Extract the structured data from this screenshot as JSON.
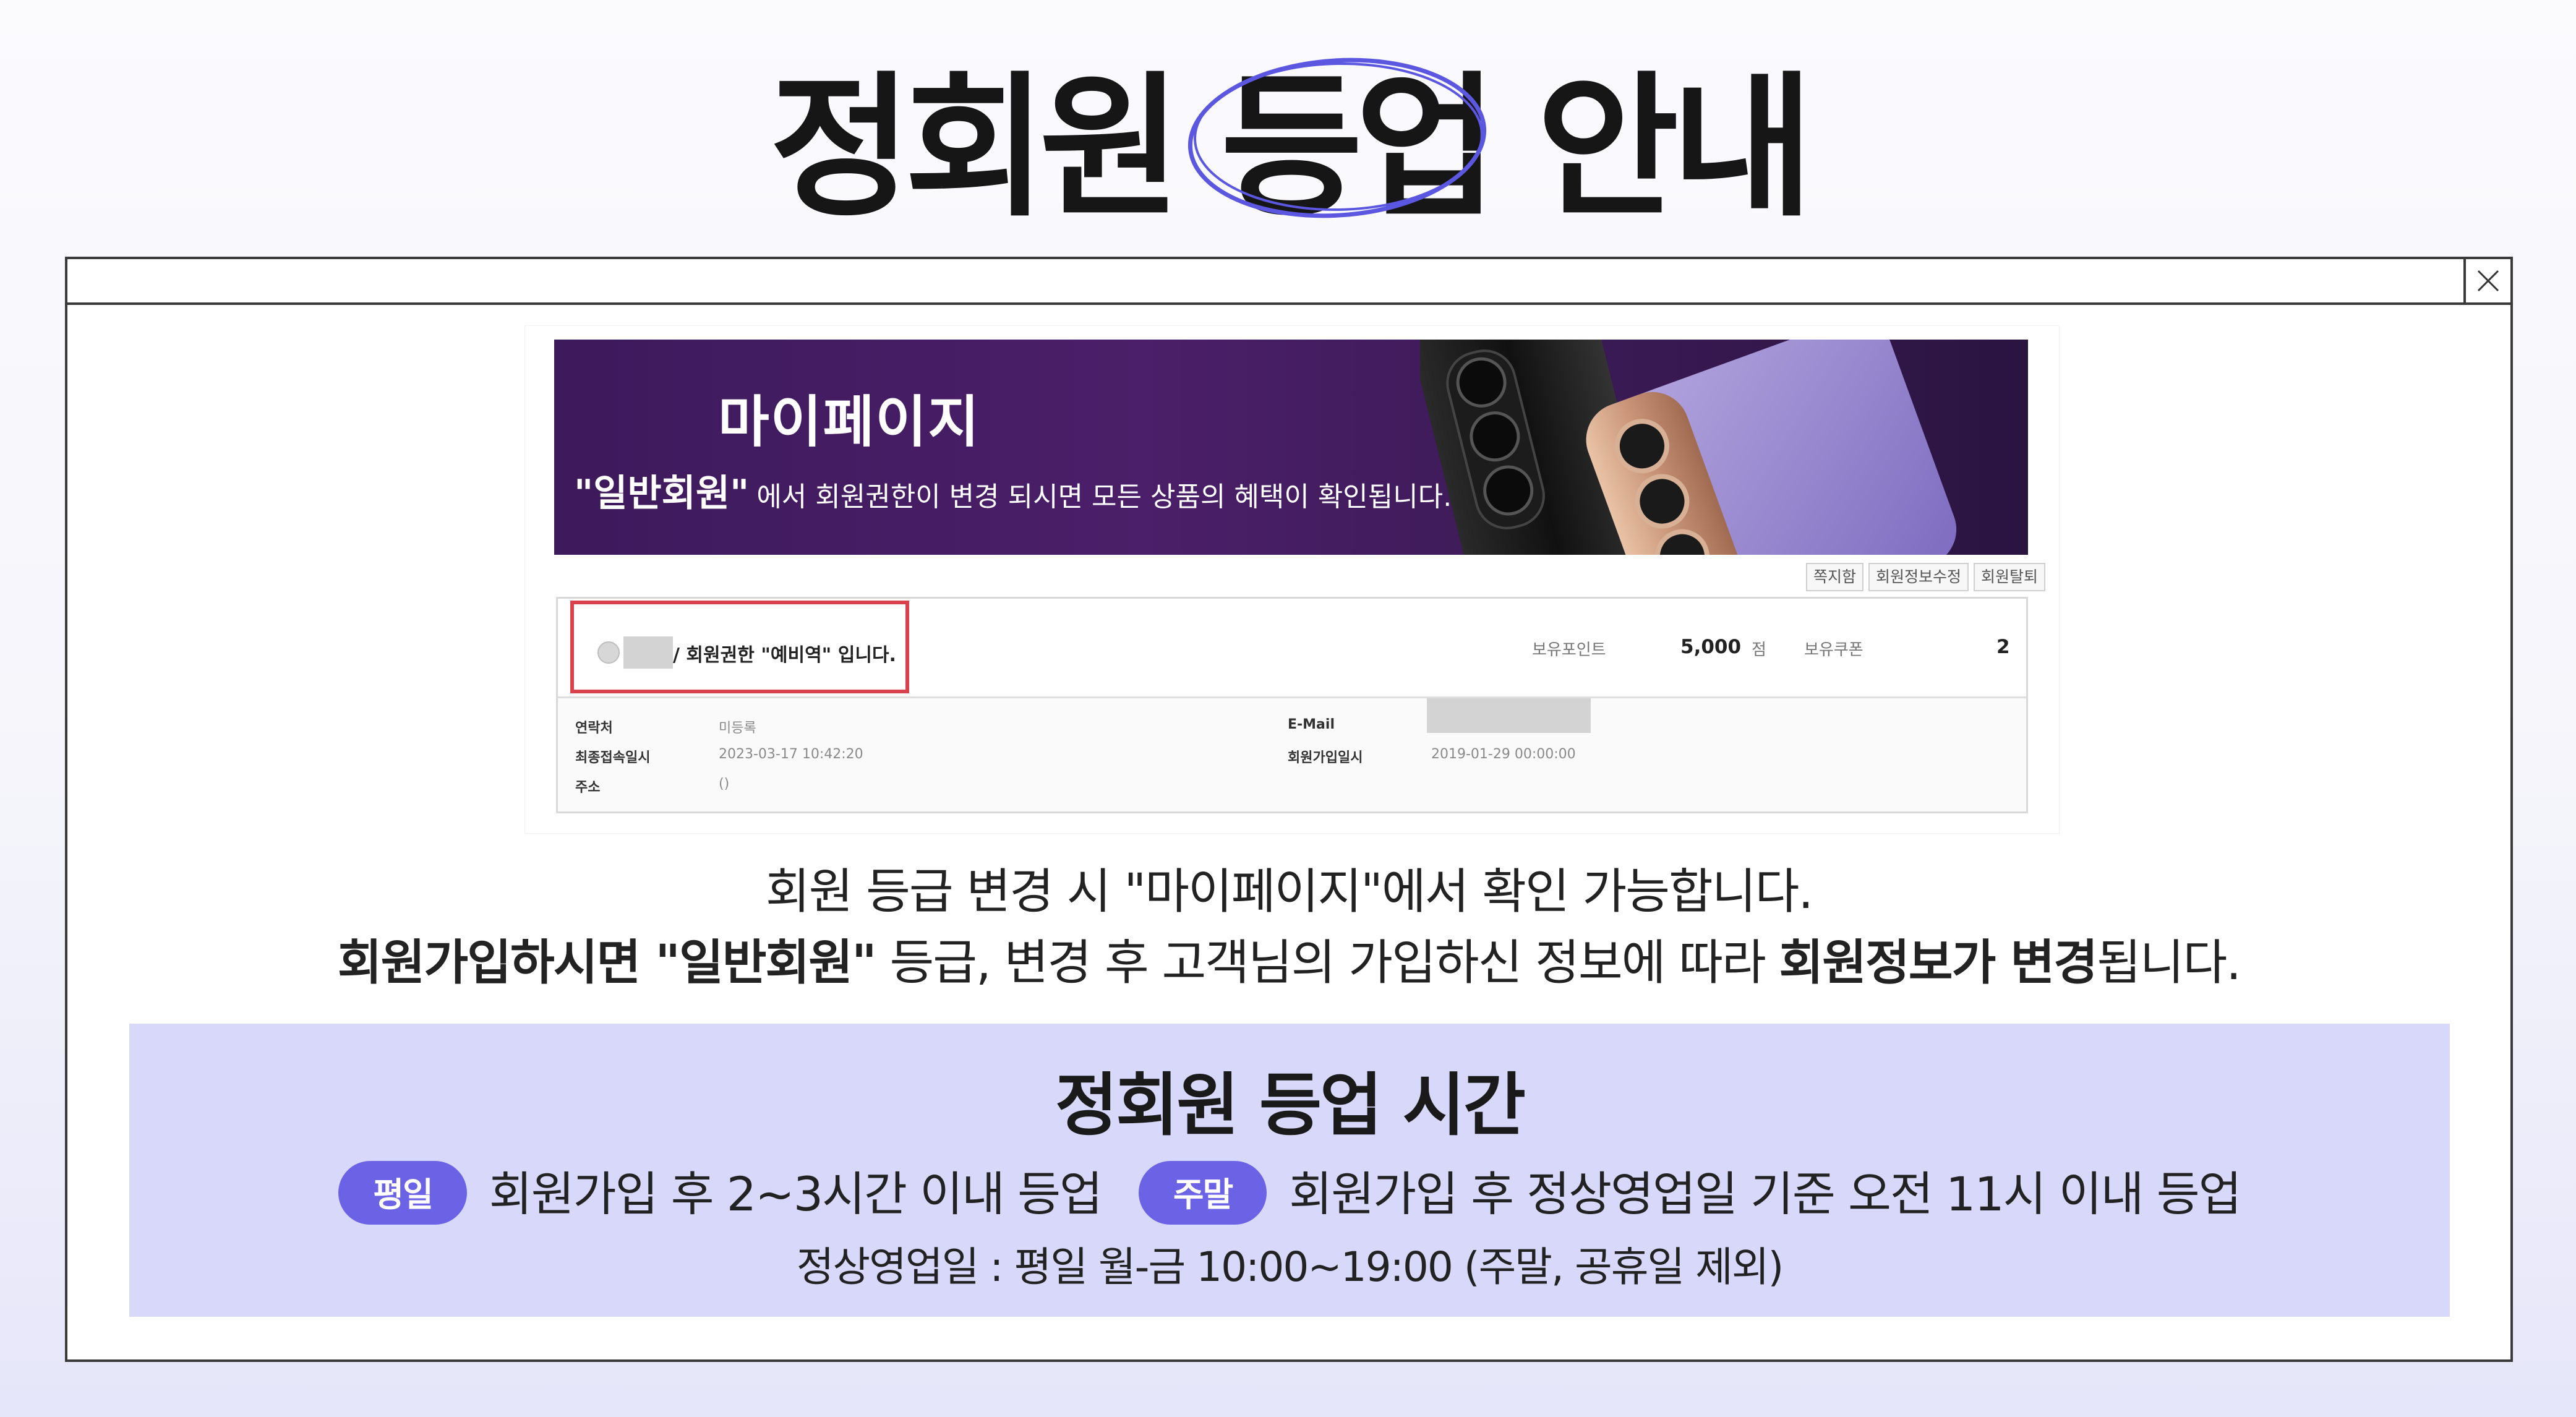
{
  "colors": {
    "accent": "#6b62e6",
    "panel_bg": "#d8d8fb",
    "highlight_border": "#d9424d",
    "banner_bg": "#4b1f69",
    "title_circle": "#5b57e0"
  },
  "title": {
    "before": "정회원",
    "highlight": "등업",
    "after": "안내"
  },
  "window": {
    "close_icon": "close-icon"
  },
  "screenshot": {
    "banner": {
      "title": "마이페이지",
      "emphasis": "\"일반회원\"",
      "text": "에서 회원권한이 변경 되시면 모든 상품의 혜택이 확인됩니다."
    },
    "buttons": [
      "쪽지함",
      "회원정보수정",
      "회원탈퇴"
    ],
    "grade_text": "/ 회원권한 \"예비역\" 입니다.",
    "points_label": "보유포인트",
    "points_value": "5,000",
    "points_unit": "점",
    "coupon_label": "보유쿠폰",
    "coupon_value": "2",
    "rows": {
      "contact_label": "연락처",
      "contact_value": "미등록",
      "last_login_label": "최종접속일시",
      "last_login_value": "2023-03-17 10:42:20",
      "address_label": "주소",
      "address_value": "()",
      "email_label": "E-Mail",
      "join_date_label": "회원가입일시",
      "join_date_value": "2019-01-29 00:00:00"
    }
  },
  "description": {
    "line1": "회원 등급 변경 시 \"마이페이지\"에서 확인 가능합니다.",
    "line2_bold_a": "회원가입하시면 \"일반회원\"",
    "line2_text_a": " 등급, 변경 후 고객님의 가입하신 정보에 따라 ",
    "line2_bold_b": "회원정보가 변경",
    "line2_text_b": "됩니다."
  },
  "upgrade_panel": {
    "title": "정회원 등업 시간",
    "weekday_badge": "평일",
    "weekday_text": "회원가입 후 2~3시간 이내 등업",
    "weekend_badge": "주말",
    "weekend_text": "회원가입 후 정상영업일 기준 오전 11시 이내 등업",
    "note": "정상영업일 : 평일 월-금 10:00~19:00 (주말, 공휴일 제외)"
  }
}
